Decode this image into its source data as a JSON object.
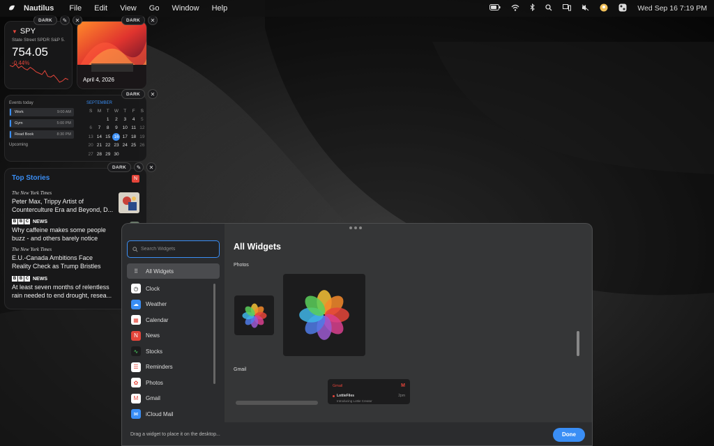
{
  "menubar": {
    "app_name": "Nautilus",
    "menus": [
      "File",
      "Edit",
      "View",
      "Go",
      "Window",
      "Help"
    ],
    "clock": "Wed Sep 16  7:19 PM"
  },
  "widget_controls": {
    "theme_label": "DARK"
  },
  "stock_widget": {
    "symbol": "SPY",
    "name": "State Street SPDR S&P 5...",
    "price": "754.05",
    "change": "-0.44%",
    "chart_points": [
      62,
      60,
      64,
      58,
      61,
      57,
      55,
      59,
      56,
      52,
      50,
      48,
      54,
      45,
      44,
      47,
      42,
      36,
      38,
      42,
      40
    ]
  },
  "photo_widget": {
    "date": "April 4, 2026"
  },
  "calendar_widget": {
    "events_label": "Events today",
    "events": [
      {
        "title": "Work",
        "time": "9:00 AM"
      },
      {
        "title": "Gym",
        "time": "5:00 PM"
      },
      {
        "title": "Read Book",
        "time": "8:30 PM"
      }
    ],
    "upcoming_label": "Upcoming",
    "month": "SEPTEMBER",
    "weekday_headers": [
      "S",
      "M",
      "T",
      "W",
      "T",
      "F",
      "S"
    ],
    "weeks": [
      [
        "",
        "",
        "1",
        "2",
        "3",
        "4",
        "5"
      ],
      [
        "6",
        "7",
        "8",
        "9",
        "10",
        "11",
        "12"
      ],
      [
        "13",
        "14",
        "15",
        "16",
        "17",
        "18",
        "19"
      ],
      [
        "20",
        "21",
        "22",
        "23",
        "24",
        "25",
        "26"
      ],
      [
        "27",
        "28",
        "29",
        "30",
        "",
        "",
        ""
      ]
    ],
    "today": "16"
  },
  "news_widget": {
    "title": "Top Stories",
    "stories": [
      {
        "source": "The New York Times",
        "source_type": "nyt",
        "headline_1": "Peter Max, Trippy Artist of",
        "headline_2": "Counterculture Era and Beyond, D..."
      },
      {
        "source": "NEWS",
        "source_type": "bbc",
        "headline_1": "Why caffeine makes some people",
        "headline_2": "buzz - and others barely notice"
      },
      {
        "source": "The New York Times",
        "source_type": "nyt",
        "headline_1": "E.U.-Canada Ambitions Face",
        "headline_2": "Reality Check as Trump Bristles"
      },
      {
        "source": "NEWS",
        "source_type": "bbc",
        "headline_1": "At least seven months of relentless",
        "headline_2": "rain needed to end drought, resea..."
      }
    ]
  },
  "gallery": {
    "search_placeholder": "Search Widgets",
    "heading": "All Widgets",
    "sidebar_items": [
      {
        "label": "All Widgets",
        "icon": "grid-icon",
        "color": "#4a4b4e"
      },
      {
        "label": "Clock",
        "icon": "clock-icon",
        "color": "#ffffff"
      },
      {
        "label": "Weather",
        "icon": "cloud-icon",
        "color": "#3a8ef5"
      },
      {
        "label": "Calendar",
        "icon": "calendar-icon",
        "color": "#ffffff"
      },
      {
        "label": "News",
        "icon": "news-icon",
        "color": "#e5453a"
      },
      {
        "label": "Stocks",
        "icon": "stocks-icon",
        "color": "#1c1c1d"
      },
      {
        "label": "Reminders",
        "icon": "reminders-icon",
        "color": "#ffffff"
      },
      {
        "label": "Photos",
        "icon": "photos-icon",
        "color": "#ffffff"
      },
      {
        "label": "Gmail",
        "icon": "gmail-icon",
        "color": "#ffffff"
      },
      {
        "label": "iCloud Mail",
        "icon": "mail-icon",
        "color": "#3a8ef5"
      }
    ],
    "sections": [
      "Photos",
      "Gmail"
    ],
    "gmail_preview": {
      "title": "Gmail",
      "sender": "LottieFiles",
      "snippet": "Introducing Lottie Creator",
      "time": "2pm"
    },
    "hint": "Drag a widget to place it on the desktop...",
    "done_label": "Done"
  },
  "colors": {
    "accent": "#3a8ef5",
    "negative": "#e5453a"
  }
}
